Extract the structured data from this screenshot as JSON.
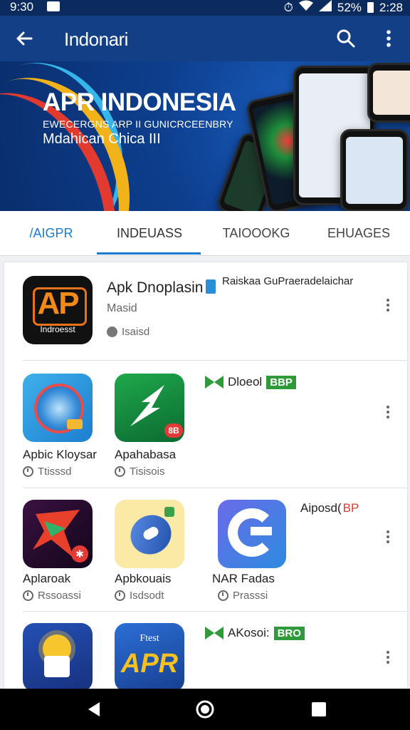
{
  "status": {
    "time": "9:30",
    "battery": "52%",
    "clock": "2:28"
  },
  "toolbar": {
    "title": "Indonari",
    "back_icon": "arrow-left-icon",
    "search_icon": "search-icon",
    "more_icon": "more-vert-icon"
  },
  "banner": {
    "title": "APR INDONESIA",
    "subtitle": "EWECERGNS ARP  II  GUNICRCEENBRY",
    "tagline": "Mdahican Chica III"
  },
  "tabs": [
    "/AIGPR",
    "INDEUASS",
    "TAIOOOKG",
    "EHUAGES"
  ],
  "featured": {
    "name": "Apk Dnoplasin",
    "side_text": "Raiskaa GuPraeradelaichar",
    "subtitle": "Masid",
    "meta": "Isaisd",
    "icon_text_top": "AP",
    "icon_text_bottom": "Indroesst"
  },
  "row2": {
    "tag_label": "Dloeol",
    "tag_badge": "BBP",
    "apps": [
      {
        "name": "Apbic Kloysar",
        "meta": "Ttisssd"
      },
      {
        "name": "Apahabasa",
        "meta": "Tisisois",
        "badge": "8B"
      }
    ]
  },
  "row3": {
    "tag_label": "Aiposd(",
    "tag_badge": "BP",
    "apps": [
      {
        "name": "Aplaroak",
        "meta": "Rssoassi"
      },
      {
        "name": "Apbkouais",
        "meta": "Isdsodt"
      },
      {
        "name": "NAR Fadas",
        "meta": "Prasssi"
      }
    ]
  },
  "row4": {
    "tag_label": "AKosoi:",
    "tag_badge": "BRO",
    "apps": [
      {
        "name": ""
      },
      {
        "name": "",
        "icon_text_top": "Ftest",
        "icon_text_main": "APR"
      }
    ]
  },
  "colors": {
    "toolbar": "#123f86",
    "statusbar": "#0b2a5e",
    "accent": "#1a7bd1",
    "tag_green": "#2e9a3a"
  }
}
